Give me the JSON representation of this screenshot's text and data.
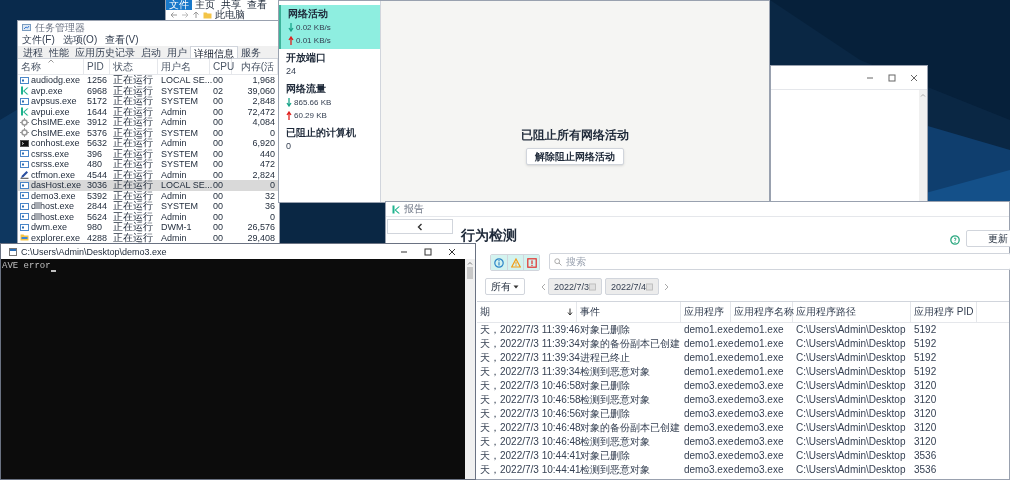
{
  "explorer": {
    "ribbon_tabs": [
      {
        "label": "文件",
        "selected": true
      },
      {
        "label": "主页",
        "selected": false
      },
      {
        "label": "共享",
        "selected": false
      },
      {
        "label": "查看",
        "selected": false
      }
    ],
    "address": "此电脑"
  },
  "task_manager": {
    "title": "任务管理器",
    "menu": [
      "文件(F)",
      "选项(O)",
      "查看(V)"
    ],
    "tabs": [
      {
        "label": "进程",
        "selected": false
      },
      {
        "label": "性能",
        "selected": false
      },
      {
        "label": "应用历史记录",
        "selected": false
      },
      {
        "label": "启动",
        "selected": false
      },
      {
        "label": "用户",
        "selected": false
      },
      {
        "label": "详细信息",
        "selected": true
      },
      {
        "label": "服务",
        "selected": false
      }
    ],
    "columns": [
      {
        "label": "名称",
        "sorted": true
      },
      {
        "label": "PID"
      },
      {
        "label": "状态"
      },
      {
        "label": "用户名"
      },
      {
        "label": "CPU"
      },
      {
        "label": "内存(活"
      }
    ],
    "rows": [
      {
        "kind": "service",
        "name": "audiodg.exe",
        "pid": "1256",
        "status": "正在运行",
        "user": "LOCAL SE...",
        "cpu": "00",
        "memory": "1,968",
        "selected": false
      },
      {
        "kind": "logo",
        "name": "avp.exe",
        "pid": "6968",
        "status": "正在运行",
        "user": "SYSTEM",
        "cpu": "02",
        "memory": "39,060",
        "selected": false
      },
      {
        "kind": "service",
        "name": "avpsus.exe",
        "pid": "5172",
        "status": "正在运行",
        "user": "SYSTEM",
        "cpu": "00",
        "memory": "2,848",
        "selected": false
      },
      {
        "kind": "logo",
        "name": "avpui.exe",
        "pid": "1644",
        "status": "正在运行",
        "user": "Admin",
        "cpu": "00",
        "memory": "72,472",
        "selected": false
      },
      {
        "kind": "gear",
        "name": "ChsIME.exe",
        "pid": "3912",
        "status": "正在运行",
        "user": "Admin",
        "cpu": "00",
        "memory": "4,084",
        "selected": false
      },
      {
        "kind": "gear",
        "name": "ChsIME.exe",
        "pid": "5376",
        "status": "正在运行",
        "user": "SYSTEM",
        "cpu": "00",
        "memory": "0",
        "selected": false
      },
      {
        "kind": "terminal",
        "name": "conhost.exe",
        "pid": "5632",
        "status": "正在运行",
        "user": "Admin",
        "cpu": "00",
        "memory": "6,920",
        "selected": false
      },
      {
        "kind": "service",
        "name": "csrss.exe",
        "pid": "396",
        "status": "正在运行",
        "user": "SYSTEM",
        "cpu": "00",
        "memory": "440",
        "selected": false
      },
      {
        "kind": "service",
        "name": "csrss.exe",
        "pid": "480",
        "status": "正在运行",
        "user": "SYSTEM",
        "cpu": "00",
        "memory": "472",
        "selected": false
      },
      {
        "kind": "pen",
        "name": "ctfmon.exe",
        "pid": "4544",
        "status": "正在运行",
        "user": "Admin",
        "cpu": "00",
        "memory": "2,824",
        "selected": false
      },
      {
        "kind": "service",
        "name": "dasHost.exe",
        "pid": "3036",
        "status": "正在运行",
        "user": "LOCAL SE...",
        "cpu": "00",
        "memory": "0",
        "selected": true
      },
      {
        "kind": "service",
        "name": "demo3.exe",
        "pid": "5392",
        "status": "正在运行",
        "user": "Admin",
        "cpu": "00",
        "memory": "32",
        "selected": false
      },
      {
        "kind": "service",
        "name": "dllhost.exe",
        "pid": "2844",
        "status": "正在运行",
        "user": "SYSTEM",
        "cpu": "00",
        "memory": "36",
        "selected": false
      },
      {
        "kind": "service",
        "name": "dllhost.exe",
        "pid": "5624",
        "status": "正在运行",
        "user": "Admin",
        "cpu": "00",
        "memory": "0",
        "selected": false
      },
      {
        "kind": "service",
        "name": "dwm.exe",
        "pid": "980",
        "status": "正在运行",
        "user": "DWM-1",
        "cpu": "00",
        "memory": "26,576",
        "selected": false
      },
      {
        "kind": "folder",
        "name": "explorer.exe",
        "pid": "4288",
        "status": "正在运行",
        "user": "Admin",
        "cpu": "00",
        "memory": "29,408",
        "selected": false
      }
    ]
  },
  "network_panel": {
    "sections": [
      {
        "title": "网络活动",
        "selected": true,
        "readings": [
          {
            "kind": "down",
            "text": "0.02 KB/s"
          },
          {
            "kind": "up",
            "text": "0.01 KB/s"
          }
        ]
      },
      {
        "title": "开放端口",
        "selected": false,
        "value": "24"
      },
      {
        "title": "网络流量",
        "selected": false,
        "readings": [
          {
            "kind": "down",
            "text": "865.66 KB"
          },
          {
            "kind": "up",
            "text": "60.29 KB"
          }
        ]
      },
      {
        "title": "已阻止的计算机",
        "selected": false,
        "value": "0"
      }
    ],
    "status": "已阻止所有网络活动",
    "button": "解除阻止网络活动"
  },
  "report": {
    "title": "报告",
    "heading": "行为检测",
    "update_button": "更新",
    "filters": [
      {
        "kind": "info",
        "selected": true
      },
      {
        "kind": "warning",
        "selected": true
      },
      {
        "kind": "error",
        "selected": true
      }
    ],
    "search_placeholder": "搜索",
    "type_filter": "所有",
    "date_from": "2022/7/3",
    "date_to": "2022/7/4",
    "columns": [
      {
        "label": "期",
        "sorted": true
      },
      {
        "label": "事件"
      },
      {
        "label": "应用程序"
      },
      {
        "label": "应用程序名称"
      },
      {
        "label": "应用程序路径"
      },
      {
        "label": "应用程序 PID"
      }
    ],
    "rows": [
      [
        "天，2022/7/3 11:39:46",
        "对象已删除",
        "demo1.exe",
        "demo1.exe",
        "C:\\Users\\Admin\\Desktop",
        "5192"
      ],
      [
        "天，2022/7/3 11:39:34",
        "对象的备份副本已创建",
        "demo1.exe",
        "demo1.exe",
        "C:\\Users\\Admin\\Desktop",
        "5192"
      ],
      [
        "天，2022/7/3 11:39:34",
        "进程已终止",
        "demo1.exe",
        "demo1.exe",
        "C:\\Users\\Admin\\Desktop",
        "5192"
      ],
      [
        "天，2022/7/3 11:39:34",
        "检测到恶意对象",
        "demo1.exe",
        "demo1.exe",
        "C:\\Users\\Admin\\Desktop",
        "5192"
      ],
      [
        "天，2022/7/3 10:46:58",
        "对象已删除",
        "demo3.exe",
        "demo3.exe",
        "C:\\Users\\Admin\\Desktop",
        "3120"
      ],
      [
        "天，2022/7/3 10:46:58",
        "检测到恶意对象",
        "demo3.exe",
        "demo3.exe",
        "C:\\Users\\Admin\\Desktop",
        "3120"
      ],
      [
        "天，2022/7/3 10:46:56",
        "对象已删除",
        "demo3.exe",
        "demo3.exe",
        "C:\\Users\\Admin\\Desktop",
        "3120"
      ],
      [
        "天，2022/7/3 10:46:48",
        "对象的备份副本已创建",
        "demo3.exe",
        "demo3.exe",
        "C:\\Users\\Admin\\Desktop",
        "3120"
      ],
      [
        "天，2022/7/3 10:46:48",
        "检测到恶意对象",
        "demo3.exe",
        "demo3.exe",
        "C:\\Users\\Admin\\Desktop",
        "3120"
      ],
      [
        "天，2022/7/3 10:44:41",
        "对象已删除",
        "demo3.exe",
        "demo3.exe",
        "C:\\Users\\Admin\\Desktop",
        "3536"
      ],
      [
        "天，2022/7/3 10:44:41",
        "检测到恶意对象",
        "demo3.exe",
        "demo3.exe",
        "C:\\Users\\Admin\\Desktop",
        "3536"
      ]
    ]
  },
  "console": {
    "title": "C:\\Users\\Admin\\Desktop\\demo3.exe",
    "output": "AVE error"
  }
}
